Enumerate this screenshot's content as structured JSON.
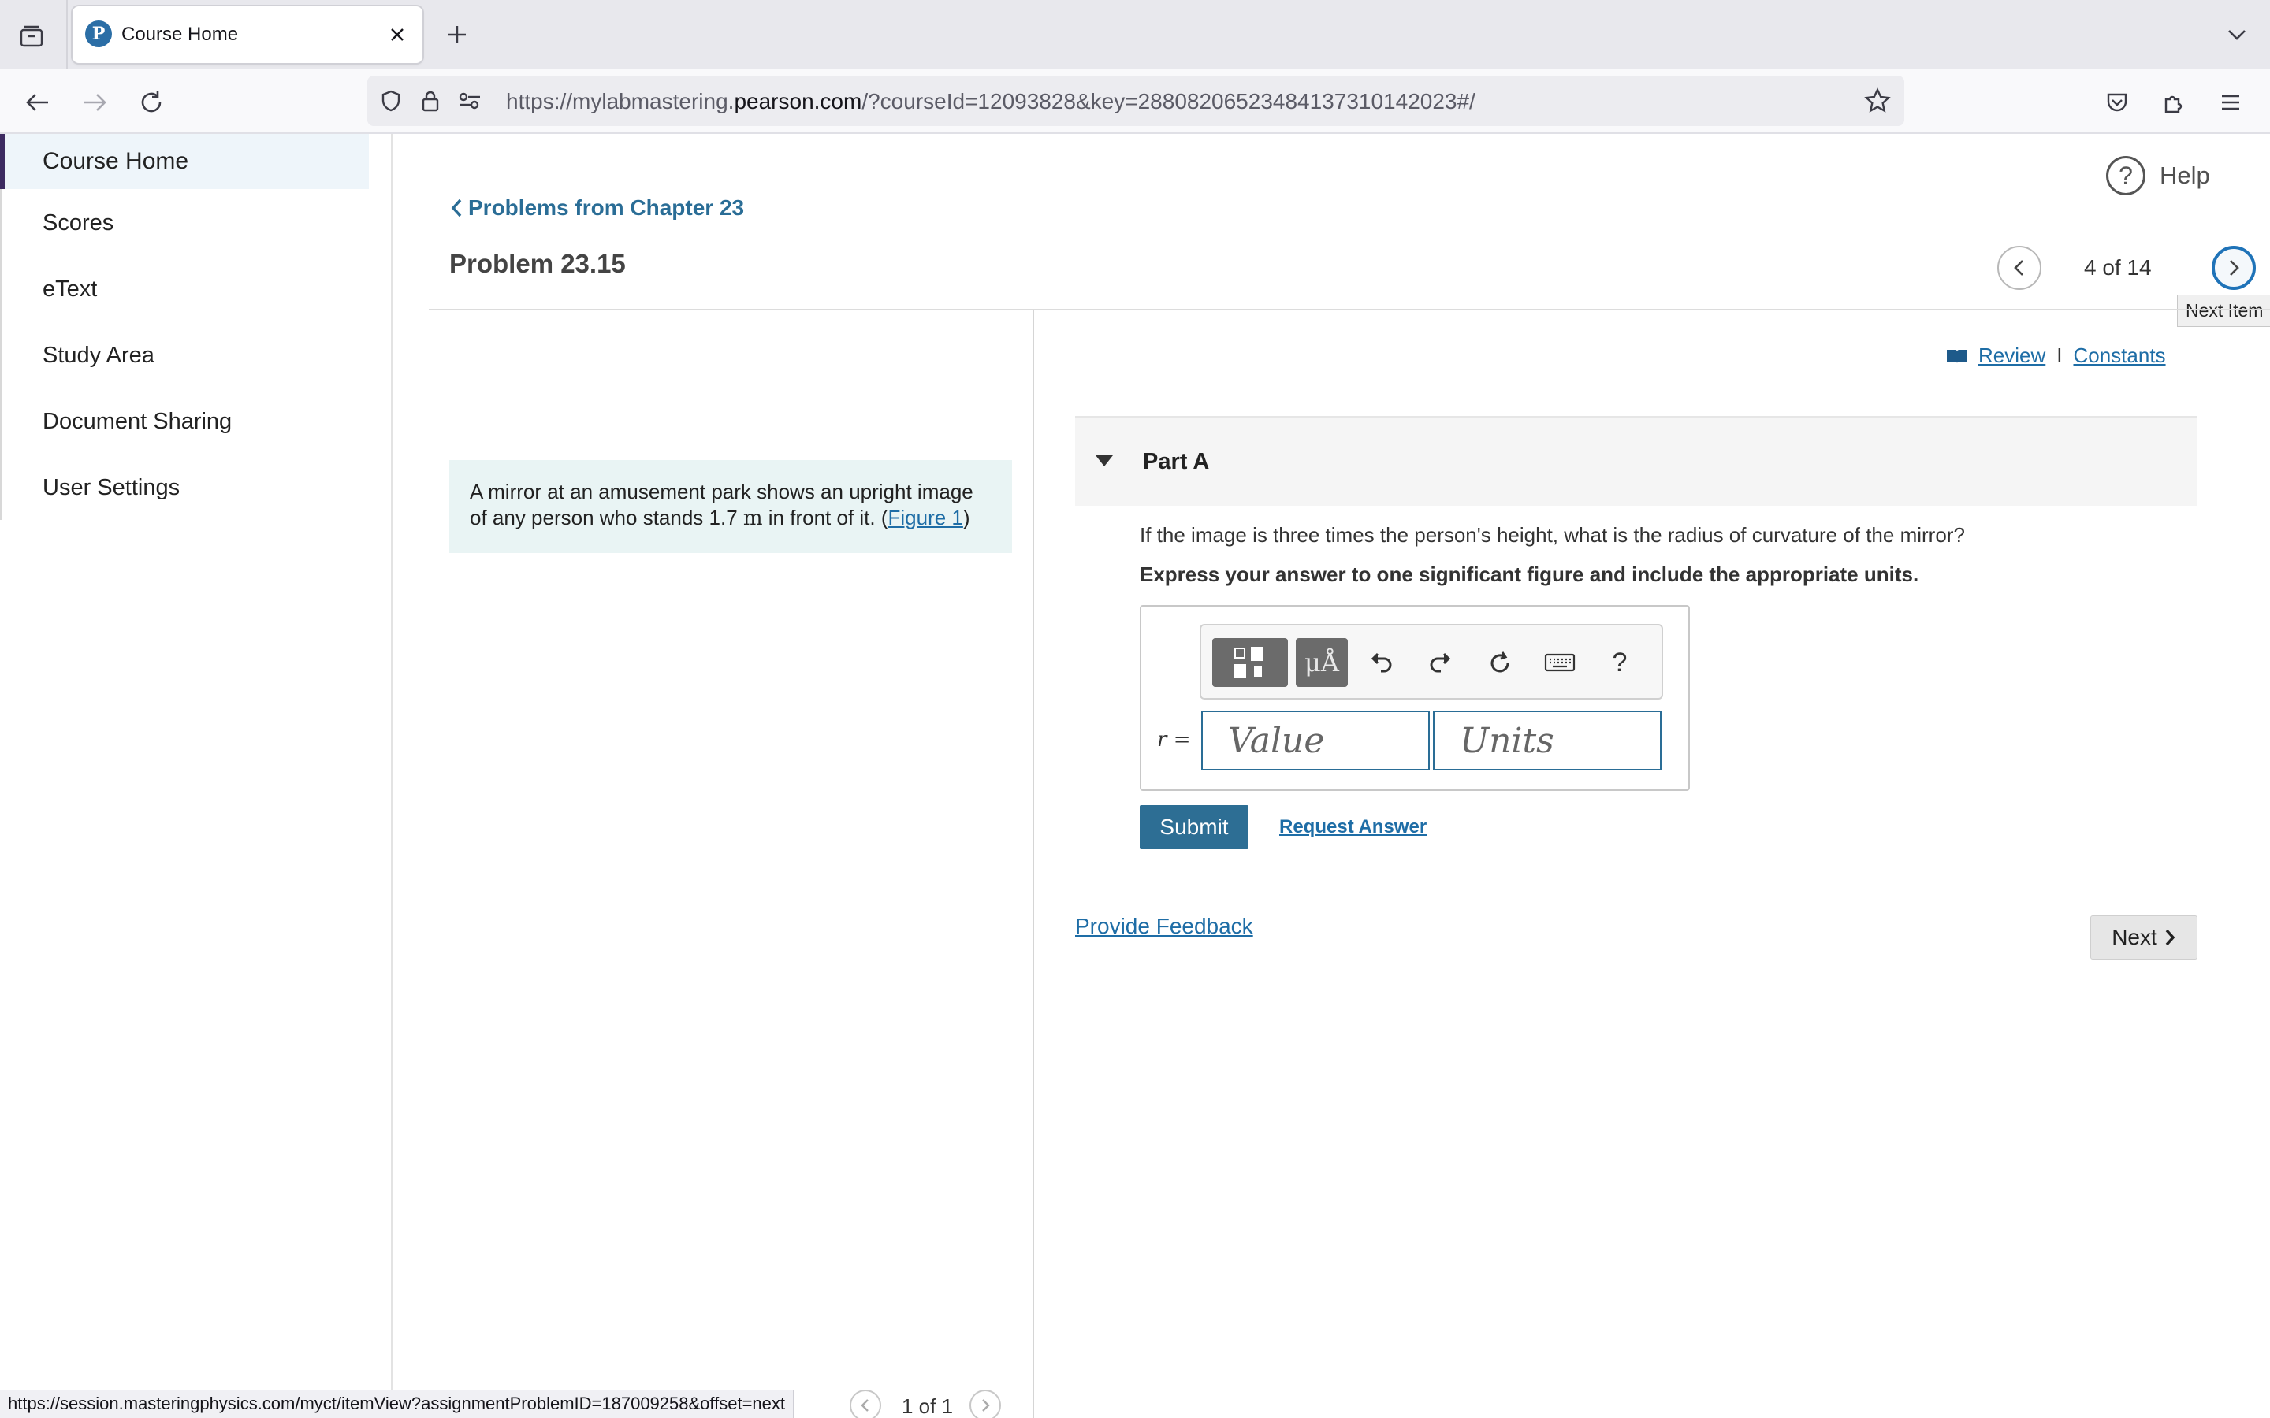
{
  "browser": {
    "tab_title": "Course Home",
    "url_prefix": "https://mylabmastering.",
    "url_host": "pearson.com",
    "url_suffix": "/?courseId=12093828&key=288082065234841373101420​23#/",
    "status_url": "https://session.masteringphysics.com/myct/itemView?assignmentProblemID=187009258&offset=next"
  },
  "sidebar": {
    "items": [
      {
        "label": "Course Home",
        "active": true
      },
      {
        "label": "Scores"
      },
      {
        "label": "eText"
      },
      {
        "label": "Study Area"
      },
      {
        "label": "Document Sharing"
      },
      {
        "label": "User Settings"
      }
    ]
  },
  "header": {
    "help_label": "Help",
    "back_link": "Problems from Chapter 23",
    "problem_title": "Problem 23.15",
    "pager_text": "4 of 14",
    "next_tooltip": "Next Item"
  },
  "intro": {
    "text_before": "A mirror at an amusement park shows an upright image of any person who stands 1.7 ",
    "unit": "m",
    "text_after": " in front of it. (",
    "figure_link": "Figure 1",
    "close_paren": ")"
  },
  "links": {
    "review": "Review",
    "separator": "I",
    "constants": "Constants"
  },
  "part": {
    "title": "Part A",
    "question": "If the image is three times the person's height, what is the radius of curvature of the mirror?",
    "instruction": "Express your answer to one significant figure and include the appropriate units.",
    "mu_label": "μÅ",
    "help_mark": "?",
    "variable": "r",
    "equals": "=",
    "value_placeholder": "Value",
    "units_placeholder": "Units",
    "submit": "Submit",
    "request_answer": "Request Answer"
  },
  "footer": {
    "feedback": "Provide Feedback",
    "next": "Next",
    "bottom_pager": "1 of 1"
  },
  "colors": {
    "link": "#1e6da6",
    "submit_bg": "#2d6e94",
    "sidebar_active_bar": "#3d2b61",
    "intro_bg": "#e9f4f4"
  }
}
